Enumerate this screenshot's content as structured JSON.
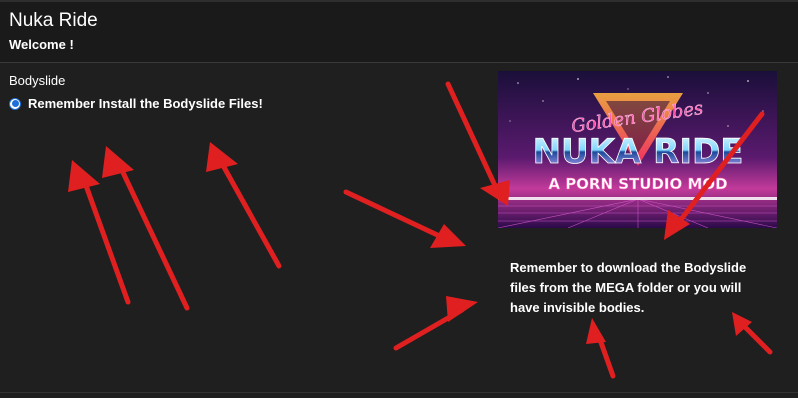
{
  "window": {
    "title": "Nuka Ride",
    "subtitle": "Welcome !"
  },
  "group": {
    "label": "Bodyslide",
    "options": [
      {
        "label": "Remember Install the Bodyslide Files!",
        "selected": true
      }
    ]
  },
  "image": {
    "line1": "Golden Globes",
    "line2": "NUKA RIDE",
    "line3": "A PORN STUDIO MOD"
  },
  "description": "Remember to download the Bodyslide files from the MEGA folder or you will have invisible bodies.",
  "colors": {
    "background": "#1f1f1f",
    "accent": "#1e6fd9",
    "annotation_arrow": "#e02020"
  }
}
